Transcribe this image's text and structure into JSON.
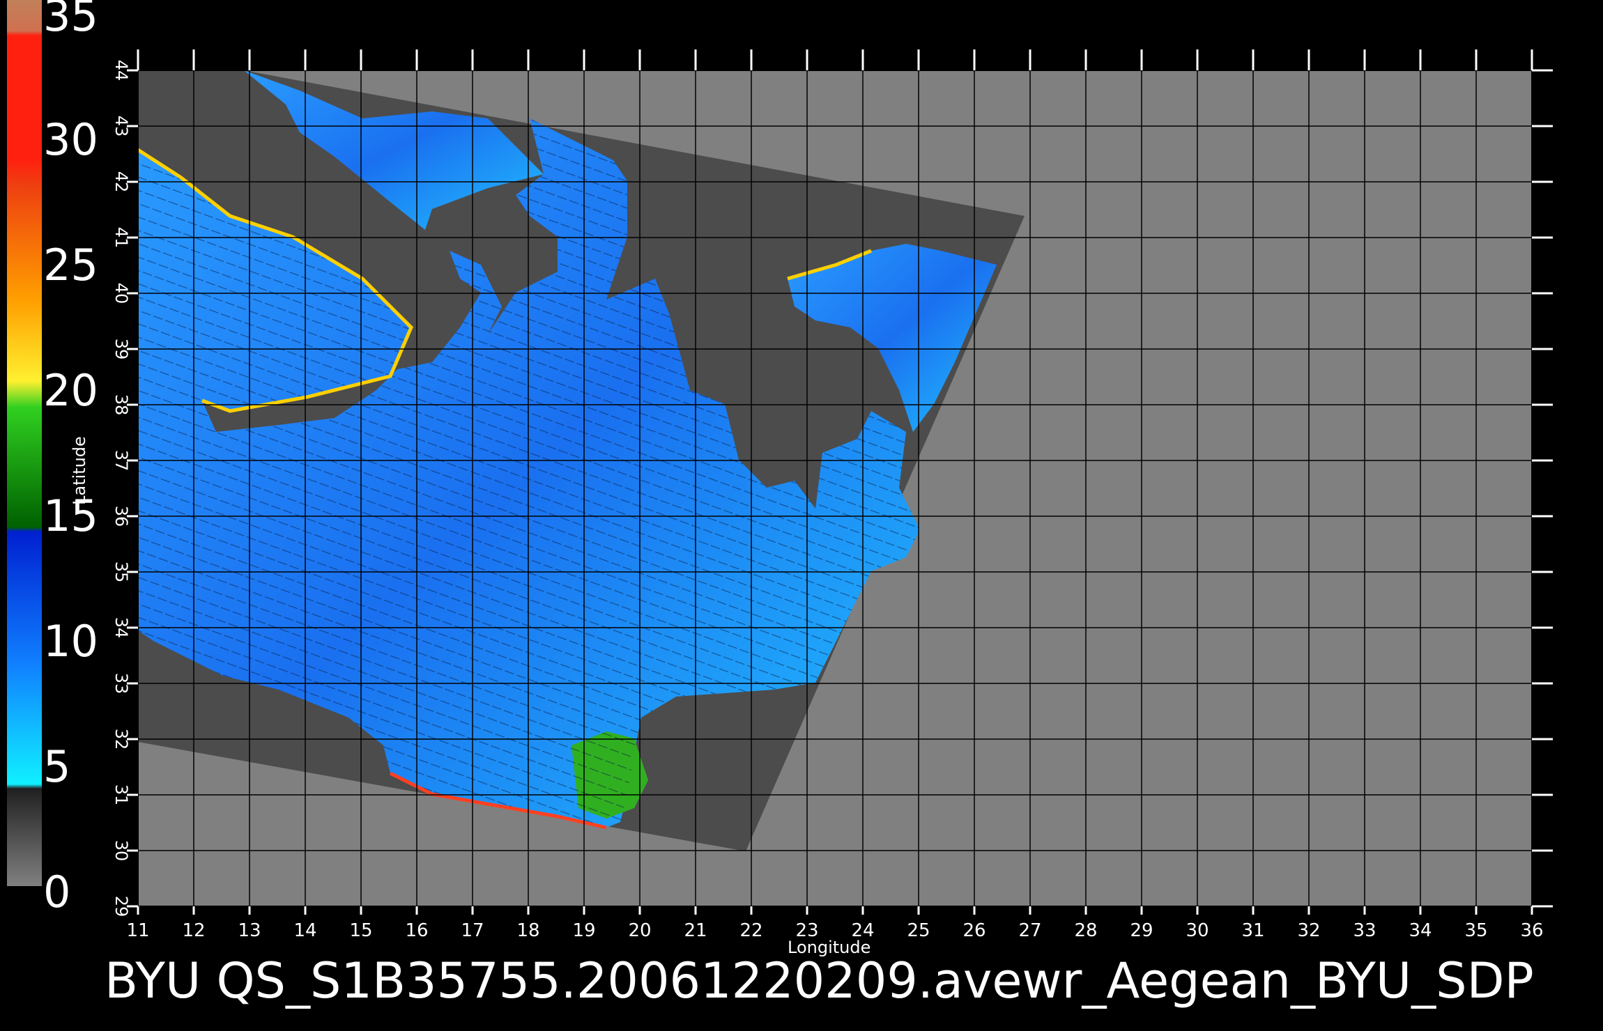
{
  "title": "BYU  QS_S1B35755.20061220209.avewr_Aegean_BYU_SDP",
  "x_axis": {
    "label": "Longitude",
    "ticks": [
      "11",
      "12",
      "13",
      "14",
      "15",
      "16",
      "17",
      "18",
      "19",
      "20",
      "21",
      "22",
      "23",
      "24",
      "25",
      "26",
      "27",
      "28",
      "29",
      "30",
      "31",
      "32",
      "33",
      "34",
      "35",
      "36"
    ]
  },
  "y_axis": {
    "label": "Latitude",
    "ticks": [
      "29",
      "30",
      "31",
      "32",
      "33",
      "34",
      "35",
      "36",
      "37",
      "38",
      "39",
      "40",
      "41",
      "42",
      "43",
      "44"
    ]
  },
  "colorbar": {
    "labels": [
      "35",
      "30",
      "25",
      "20",
      "15",
      "10",
      "5",
      "0"
    ],
    "segments": [
      {
        "color": "#c87850"
      },
      {
        "color": "#ff2020"
      },
      {
        "color": "#ee5010"
      },
      {
        "color": "#ffc000"
      },
      {
        "color": "#20c020"
      },
      {
        "color": "#1040ff"
      },
      {
        "color": "#10e0ff"
      },
      {
        "color": "#606060"
      }
    ]
  },
  "colors": {
    "background": "#000000",
    "land": "#808080",
    "swath": "#4c4c4c",
    "ocean": "#1c8cff",
    "grid": "#000000"
  }
}
